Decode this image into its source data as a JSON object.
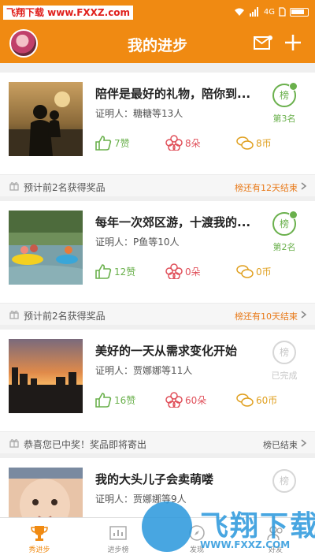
{
  "watermark_top": "飞翔下载 www.FXXZ.com",
  "status": {
    "network": "4G"
  },
  "header": {
    "title": "我的进步"
  },
  "colors": {
    "brand": "#f08a12",
    "green": "#6ab04c",
    "red": "#e0505a",
    "gold": "#e0a020"
  },
  "cards": [
    {
      "title": "陪伴是最好的礼物，陪你到...",
      "certifier": "证明人：糖糖等13人",
      "rank_badge": "榜",
      "rank_label": "第3名",
      "likes": "7赞",
      "flowers": "8朵",
      "coins": "8币",
      "footer_left": "预计前2名获得奖品",
      "footer_right": "榜还有12天结束"
    },
    {
      "title": "每年一次郊区游，十渡我的...",
      "certifier": "证明人：P鱼等10人",
      "rank_badge": "榜",
      "rank_label": "第2名",
      "likes": "12赞",
      "flowers": "0朵",
      "coins": "0币",
      "footer_left": "预计前2名获得奖品",
      "footer_right": "榜还有10天结束"
    },
    {
      "title": "美好的一天从需求变化开始",
      "certifier": "证明人：贾娜娜等11人",
      "rank_badge": "榜",
      "rank_label": "已完成",
      "likes": "16赞",
      "flowers": "60朵",
      "coins": "60币",
      "footer_left": "恭喜您已中奖！奖品即将寄出",
      "footer_right": "榜已结束"
    },
    {
      "title": "我的大头儿子会卖萌喽",
      "certifier": "证明人：贾娜娜等9人",
      "rank_badge": "榜"
    }
  ],
  "nav": [
    {
      "label": "秀进步",
      "icon": "trophy-icon"
    },
    {
      "label": "进步榜",
      "icon": "ranking-icon"
    },
    {
      "label": "发现",
      "icon": "discover-icon"
    },
    {
      "label": "好友",
      "icon": "friends-icon"
    }
  ],
  "watermark_bottom": {
    "text": "飞翔下载",
    "url": "WWW.FXXZ.COM"
  }
}
